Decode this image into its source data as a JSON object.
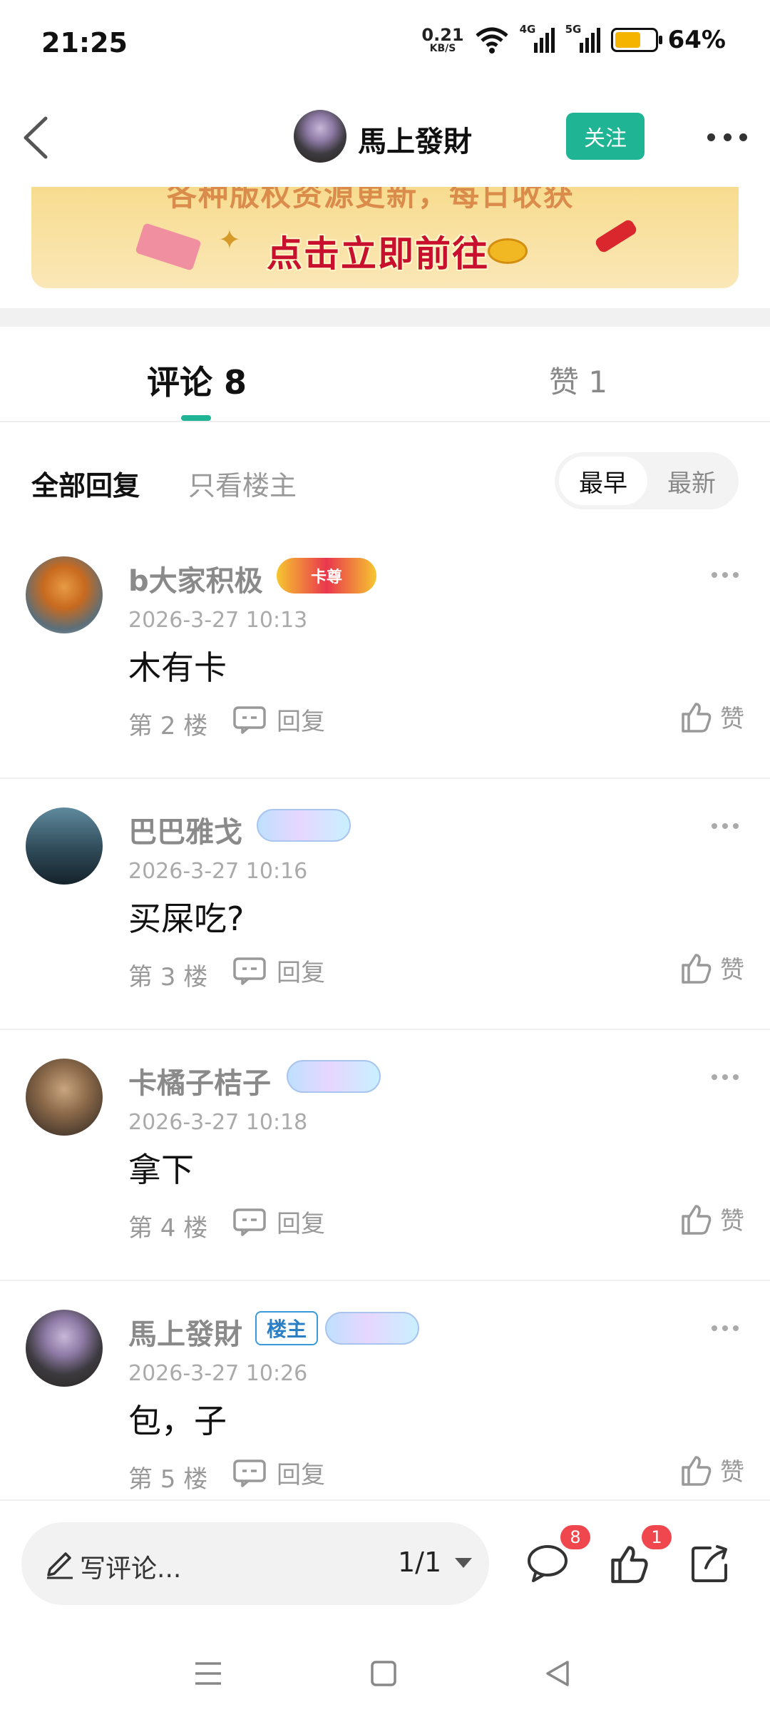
{
  "status_bar": {
    "time": "21:25",
    "net_speed_value": "0.21",
    "net_speed_unit": "KB/S",
    "signal_1_label": "4G",
    "signal_2_label": "5G",
    "battery_pct": "64%",
    "battery_level": 0.64,
    "battery_color": "#f4b400"
  },
  "header": {
    "title": "馬上發財",
    "follow_label": "关注",
    "accent_color": "#1fb494"
  },
  "banner": {
    "top_text": "各种版权资源更新，每日收获",
    "cta": "点击立即前往"
  },
  "tabs": {
    "comments_label": "评论 8",
    "likes_label": "赞 1"
  },
  "filter": {
    "all_replies": "全部回复",
    "op_only": "只看楼主",
    "sort_earliest": "最早",
    "sort_latest": "最新"
  },
  "comments": [
    {
      "name": "b大家积极",
      "badge": "卡尊",
      "time": "2026-3-27 10:13",
      "text": "木有卡",
      "floor": "第 2 楼",
      "reply_label": "回复",
      "like_label": "赞"
    },
    {
      "name": "巴巴雅戈",
      "time": "2026-3-27 10:16",
      "text": "买屎吃?",
      "floor": "第 3 楼",
      "reply_label": "回复",
      "like_label": "赞"
    },
    {
      "name": "卡橘子桔子",
      "time": "2026-3-27 10:18",
      "text": "拿下",
      "floor": "第 4 楼",
      "reply_label": "回复",
      "like_label": "赞"
    },
    {
      "name": "馬上發財",
      "op_badge": "楼主",
      "time": "2026-3-27 10:26",
      "text": "包，子",
      "floor": "第 5 楼",
      "reply_label": "回复",
      "like_label": "赞"
    }
  ],
  "bottom_bar": {
    "write_placeholder": "写评论...",
    "page_indicator": "1/1",
    "comment_count": "8",
    "like_count": "1"
  },
  "icons": [
    "back-icon",
    "more-icon",
    "pencil-icon",
    "comment-icon",
    "thumb-up-icon",
    "share-icon",
    "reply-icon",
    "wifi-icon",
    "signal-icon",
    "battery-icon",
    "menu-nav-icon",
    "home-nav-icon",
    "back-nav-icon"
  ]
}
